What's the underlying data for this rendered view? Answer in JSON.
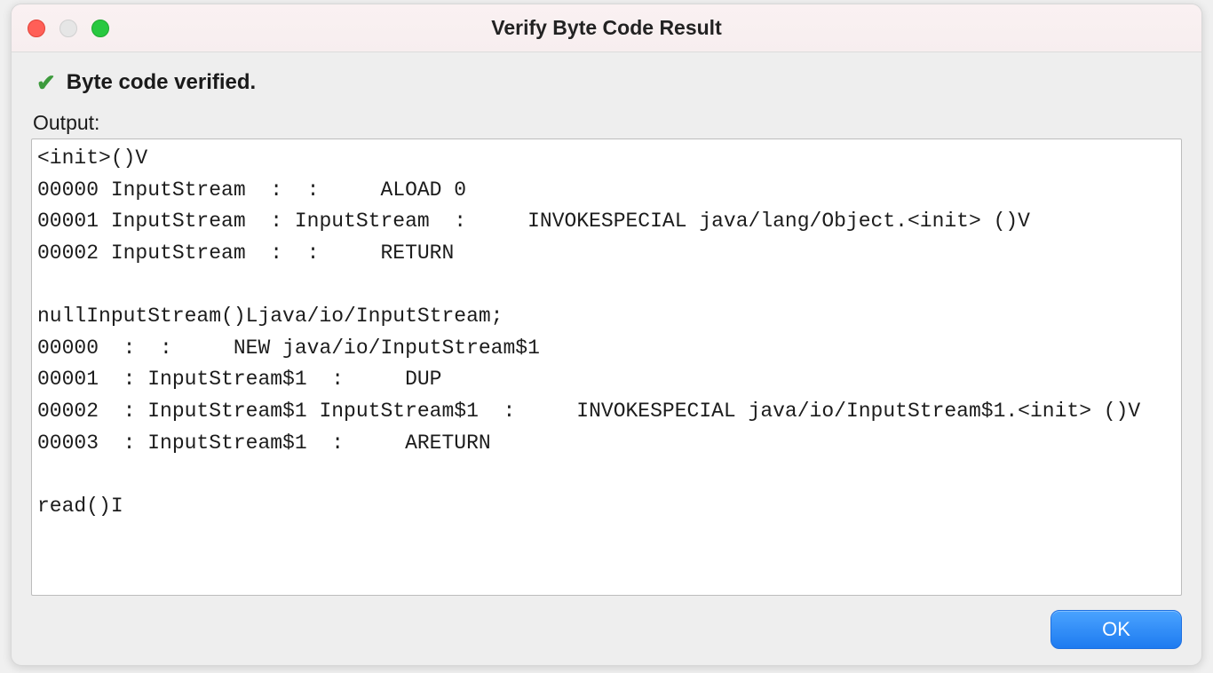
{
  "window": {
    "title": "Verify Byte Code Result"
  },
  "status": {
    "icon": "check-icon",
    "text": "Byte code verified."
  },
  "output": {
    "label": "Output:",
    "text": "<init>()V\n00000 InputStream  :  :     ALOAD 0\n00001 InputStream  : InputStream  :     INVOKESPECIAL java/lang/Object.<init> ()V\n00002 InputStream  :  :     RETURN\n\nnullInputStream()Ljava/io/InputStream;\n00000  :  :     NEW java/io/InputStream$1\n00001  : InputStream$1  :     DUP\n00002  : InputStream$1 InputStream$1  :     INVOKESPECIAL java/io/InputStream$1.<init> ()V\n00003  : InputStream$1  :     ARETURN\n\nread()I\n"
  },
  "buttons": {
    "ok": "OK"
  }
}
